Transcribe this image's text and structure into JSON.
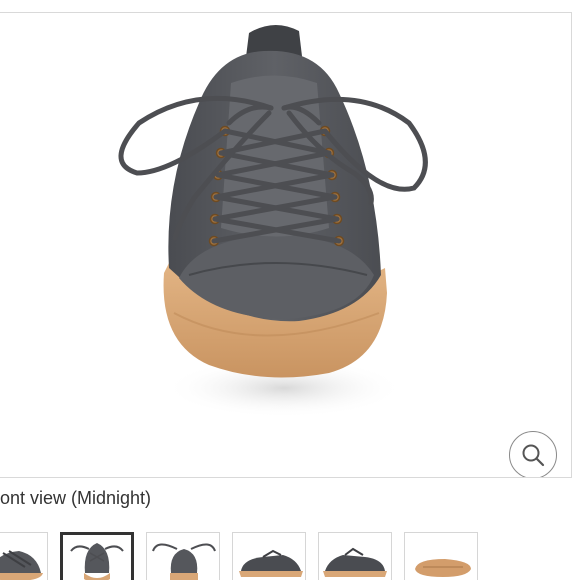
{
  "gallery": {
    "caption": "ront view (Midnight)",
    "zoom_icon": "search-icon",
    "selected_index": 1,
    "thumbnails": [
      {
        "view": "angled-side"
      },
      {
        "view": "front"
      },
      {
        "view": "back"
      },
      {
        "view": "side-profile"
      },
      {
        "view": "side-profile-other"
      },
      {
        "view": "sole"
      }
    ]
  },
  "colors": {
    "upper": "#55575c",
    "sole": "#d9a777",
    "lace": "#4d4e52",
    "eyelet": "#a3733d",
    "selected_border": "#333333",
    "frame_border": "#d9d9d9"
  }
}
